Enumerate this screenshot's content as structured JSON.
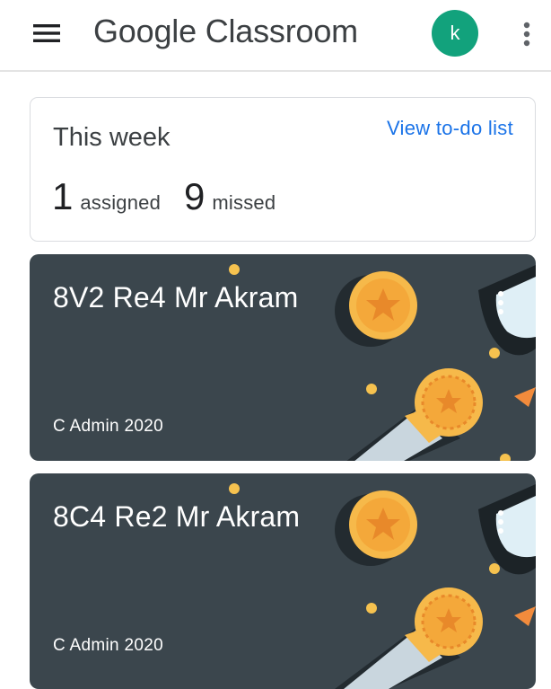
{
  "appbar": {
    "menu_icon": "hamburger-menu-icon",
    "title": "Google Classroom",
    "avatar_letter": "k",
    "avatar_color": "#12a27c",
    "overflow_icon": "more-vert-icon"
  },
  "this_week": {
    "title": "This week",
    "link": "View to-do list",
    "assigned_count": "1",
    "assigned_label": "assigned",
    "missed_count": "9",
    "missed_label": "missed"
  },
  "classes": [
    {
      "name": "8V2 Re4 Mr Akram",
      "owner": "C Admin 2020",
      "menu_icon": "more-vert-icon"
    },
    {
      "name": "8C4 Re2 Mr Akram",
      "owner": "C Admin 2020",
      "menu_icon": "more-vert-icon"
    }
  ],
  "theme": {
    "link_color": "#1a73e8",
    "card_color": "#3b464d",
    "medal_color": "#f6b94a"
  }
}
